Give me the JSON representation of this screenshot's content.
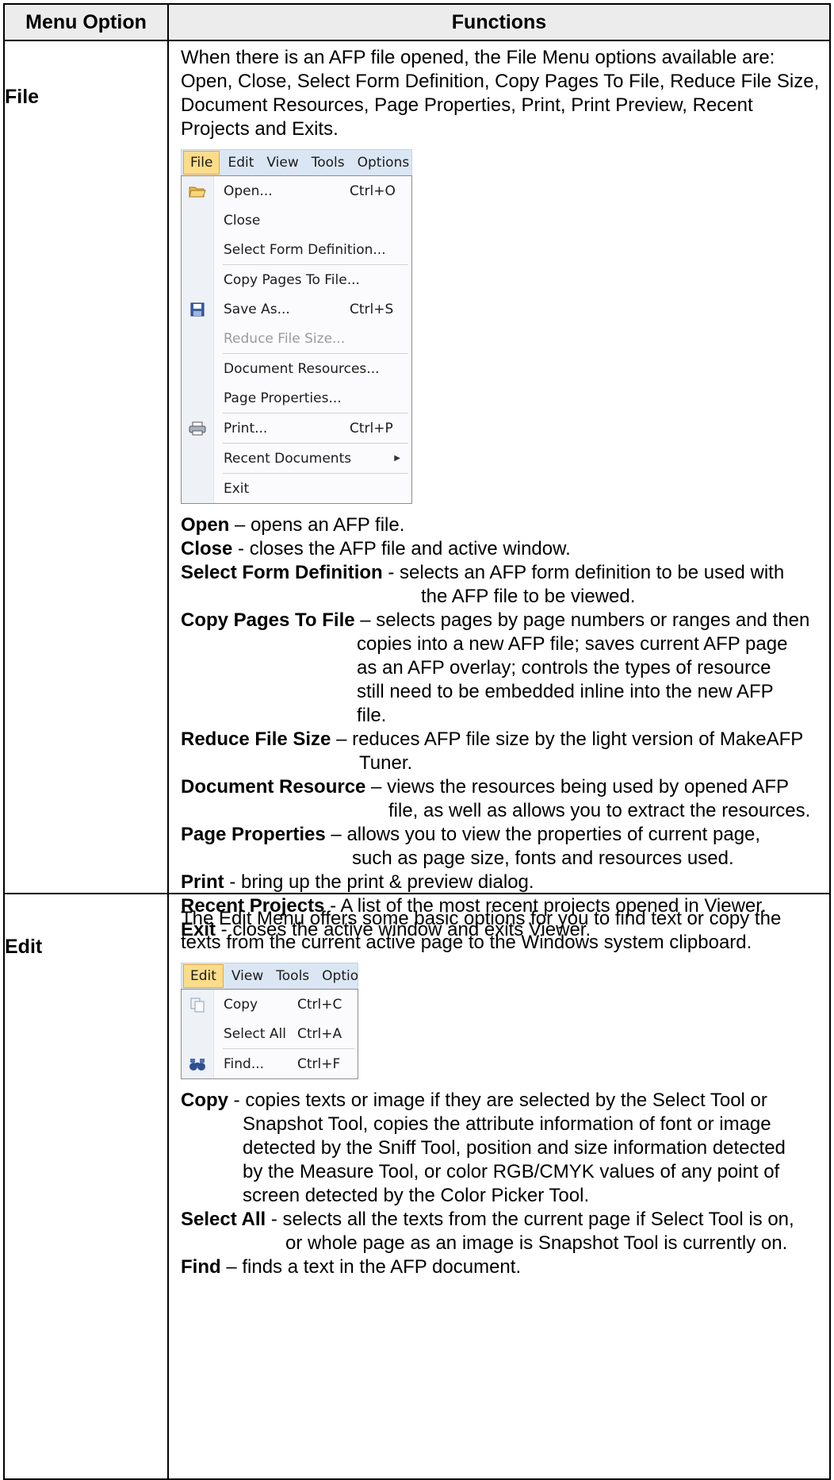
{
  "table": {
    "headers": [
      "Menu Option",
      "Functions"
    ]
  },
  "file": {
    "option": "File",
    "intro": "When there is an AFP file opened, the File Menu options available are: Open, Close, Select Form Definition, Copy Pages To File, Reduce File Size, Document Resources, Page Properties, Print, Print Preview, Recent Projects and Exits.",
    "menubar": [
      "File",
      "Edit",
      "View",
      "Tools",
      "Options"
    ],
    "menu_items": [
      {
        "label": "Open...",
        "shortcut": "Ctrl+O",
        "icon": "folder-open-icon"
      },
      {
        "label": "Close",
        "shortcut": ""
      },
      {
        "label": "Select Form Definition...",
        "shortcut": ""
      },
      {
        "label": "Copy Pages To File...",
        "shortcut": ""
      },
      {
        "label": "Save As...",
        "shortcut": "Ctrl+S",
        "icon": "floppy-disk-icon"
      },
      {
        "label": "Reduce File Size...",
        "shortcut": ""
      },
      {
        "label": "Document Resources...",
        "shortcut": ""
      },
      {
        "label": "Page Properties...",
        "shortcut": ""
      },
      {
        "label": "Print...",
        "shortcut": "Ctrl+P",
        "icon": "printer-icon"
      },
      {
        "label": "Recent Documents",
        "shortcut": ""
      },
      {
        "label": "Exit",
        "shortcut": ""
      }
    ],
    "entries": [
      {
        "term": "Open",
        "sep": " – ",
        "lines": [
          "opens an AFP file."
        ]
      },
      {
        "term": "Close",
        "sep": " - ",
        "lines": [
          "closes the AFP file and active window."
        ]
      },
      {
        "term": "Select Form Definition",
        "sep": " - ",
        "lines": [
          "selects an AFP form definition to be used with",
          "the AFP file to be viewed."
        ]
      },
      {
        "term": "Copy Pages To File",
        "sep": " – ",
        "lines": [
          "selects pages by page numbers or ranges and then",
          "copies into a new AFP file; saves current AFP page",
          "as an AFP overlay; controls the types of resource",
          "still need to be embedded inline into the new AFP",
          "file."
        ]
      },
      {
        "term": "Reduce File Size",
        "sep": " – ",
        "lines": [
          "reduces AFP file size by the light version of MakeAFP",
          "Tuner."
        ]
      },
      {
        "term": "Document Resource",
        "sep": " – ",
        "lines": [
          "views the resources being used by opened AFP",
          "file, as well as allows you to extract the resources."
        ]
      },
      {
        "term": "Page Properties",
        "sep": " – ",
        "lines": [
          "allows you to view the properties of current page,",
          "such as page size, fonts and resources used."
        ]
      },
      {
        "term": "Print",
        "sep": " - ",
        "lines": [
          "bring up the print & preview dialog."
        ]
      },
      {
        "term": "Recent Projects",
        "sep": " - ",
        "lines": [
          "A list of the most recent projects opened in Viewer."
        ]
      },
      {
        "term": "Exit",
        "sep": " - ",
        "lines": [
          "closes the active window and exits Viewer."
        ]
      }
    ]
  },
  "edit": {
    "option": "Edit",
    "intro": "The Edit Menu offers some basic options for you to find text or copy the texts from the current active page to the Windows system clipboard.",
    "menubar": [
      "Edit",
      "View",
      "Tools",
      "Optior"
    ],
    "menu_items": [
      {
        "label": "Copy",
        "shortcut": "Ctrl+C",
        "icon": "copy-icon"
      },
      {
        "label": "Select All",
        "shortcut": "Ctrl+A"
      },
      {
        "label": "Find...",
        "shortcut": "Ctrl+F",
        "icon": "binoculars-icon"
      }
    ],
    "entries": [
      {
        "term": "Copy",
        "sep": " - ",
        "lines": [
          "copies texts or image if they are selected by the Select Tool or",
          "Snapshot Tool, copies the attribute information of font or image",
          "detected by the Sniff Tool,  position and size information detected",
          "by the Measure Tool, or color RGB/CMYK values of any point of",
          "screen detected by the Color Picker Tool."
        ]
      },
      {
        "term": "Select All",
        "sep": " - ",
        "lines": [
          "selects all the texts from the current page if Select Tool is on,",
          "or whole page as an image is Snapshot Tool is currently on."
        ]
      },
      {
        "term": "Find",
        "sep": " – ",
        "lines": [
          "finds a text in the AFP document."
        ]
      }
    ]
  }
}
